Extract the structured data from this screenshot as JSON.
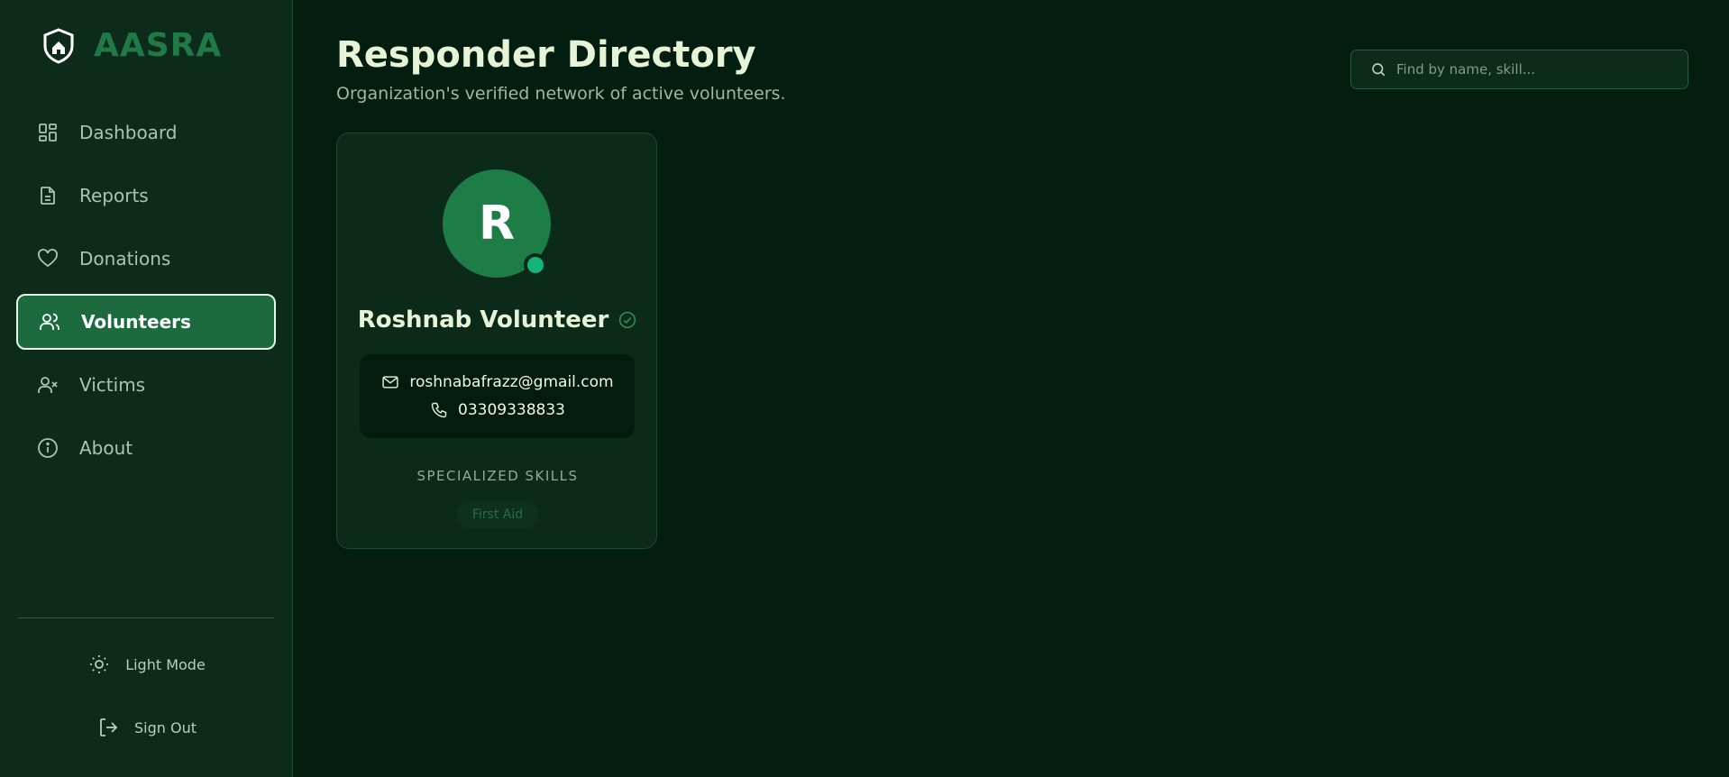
{
  "brand": {
    "name": "AASRA",
    "logo_icon": "shield-home-icon"
  },
  "sidebar": {
    "items": [
      {
        "label": "Dashboard",
        "icon": "grid-icon",
        "active": false
      },
      {
        "label": "Reports",
        "icon": "document-icon",
        "active": false
      },
      {
        "label": "Donations",
        "icon": "heart-icon",
        "active": false
      },
      {
        "label": "Volunteers",
        "icon": "users-icon",
        "active": true
      },
      {
        "label": "Victims",
        "icon": "user-x-icon",
        "active": false
      },
      {
        "label": "About",
        "icon": "info-icon",
        "active": false
      }
    ],
    "footer": {
      "light_mode_label": "Light Mode",
      "sign_out_label": "Sign Out"
    }
  },
  "header": {
    "title": "Responder Directory",
    "subtitle": "Organization's verified network of active volunteers."
  },
  "search": {
    "placeholder": "Find by name, skill...",
    "value": ""
  },
  "volunteers": [
    {
      "initial": "R",
      "name": "Roshnab Volunteer",
      "verified": true,
      "online": true,
      "email": "roshnabafrazz@gmail.com",
      "phone": "03309338833",
      "skills_heading": "SPECIALIZED SKILLS",
      "skills": [
        "First Aid"
      ]
    }
  ],
  "colors": {
    "background": "#031d11",
    "sidebar": "#0c2b1b",
    "accent": "#1d6a3f",
    "online": "#14b57a",
    "title": "#e6f3d6"
  }
}
